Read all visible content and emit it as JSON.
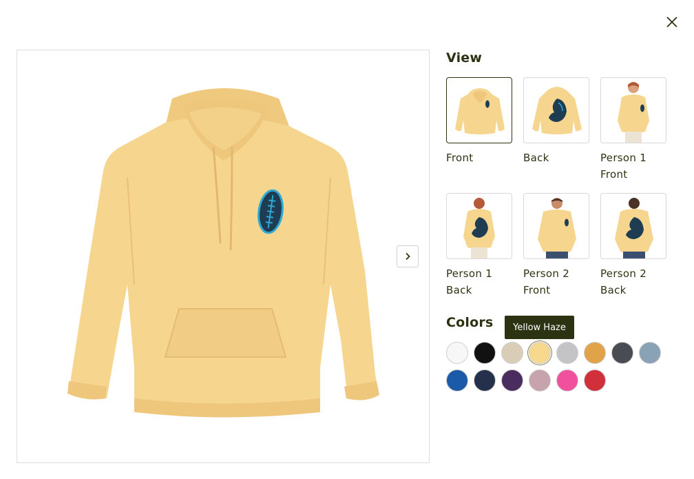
{
  "dialog": {
    "close_icon": "close-icon",
    "next_icon": "chevron-right-icon"
  },
  "view": {
    "heading": "View",
    "thumbnails": [
      {
        "line1": "Front",
        "line2": ""
      },
      {
        "line1": "Back",
        "line2": ""
      },
      {
        "line1": "Person 1",
        "line2": "Front"
      },
      {
        "line1": "Person 1",
        "line2": "Back"
      },
      {
        "line1": "Person 2",
        "line2": "Front"
      },
      {
        "line1": "Person 2",
        "line2": "Back"
      }
    ],
    "selected_index": 0
  },
  "colors": {
    "heading": "Colors",
    "tooltip": "Yellow Haze",
    "selected_index": 3,
    "swatches": [
      "#f7f7f7",
      "#111111",
      "#d9cdb8",
      "#f7d98e",
      "#c4c4c6",
      "#e0a34a",
      "#4a4c54",
      "#8aa2b6",
      "#1b5aa8",
      "#25304a",
      "#4a2c5e",
      "#c7a3ad",
      "#f0509e",
      "#d12f3a"
    ]
  },
  "product": {
    "hoodie_color": "#f6d58f",
    "ball_color": "#1f3d52",
    "lace_color": "#2fa8d4"
  }
}
